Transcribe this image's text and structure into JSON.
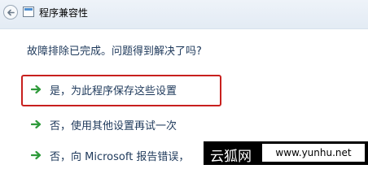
{
  "window": {
    "title": "程序兼容性"
  },
  "main": {
    "question": "故障排除已完成。问题得到解决了吗?",
    "options": [
      {
        "label": "是，为此程序保存这些设置",
        "highlighted": true
      },
      {
        "label": "否，使用其他设置再试一次",
        "highlighted": false
      },
      {
        "label": "否，向 Microsoft 报告错误，",
        "highlighted": false
      }
    ]
  },
  "watermark": {
    "name": "云狐网",
    "url": "www.yunhu.net"
  },
  "colors": {
    "arrow": "#2e9a3a",
    "highlight": "#c8201e",
    "text": "#1e395b"
  },
  "icons": {
    "back": "back-arrow-icon",
    "app": "program-compatibility-icon",
    "option": "green-arrow-icon"
  }
}
